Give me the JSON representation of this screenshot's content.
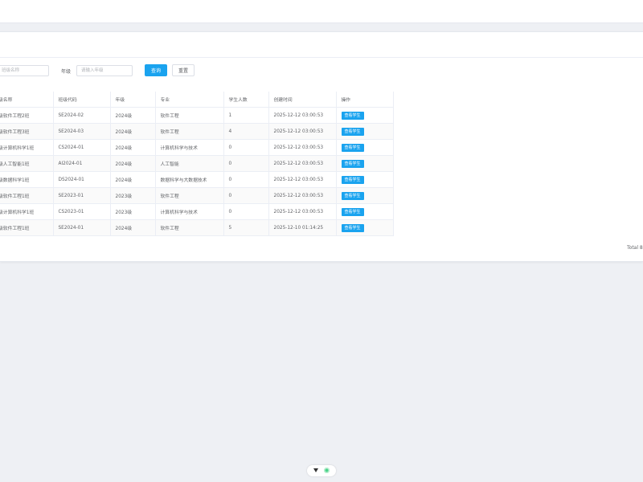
{
  "search": {
    "class_name_placeholder": "班级名称",
    "grade_label": "年级",
    "grade_placeholder": "请输入年级",
    "query_button": "查询",
    "reset_button": "重置"
  },
  "table": {
    "headers": [
      "级名称",
      "班级代码",
      "年级",
      "专业",
      "学生人数",
      "创建时间",
      "操作"
    ],
    "rows": [
      {
        "name": "级软件工程2班",
        "code": "SE2024-02",
        "grade": "2024级",
        "major": "软件工程",
        "count": "1",
        "created": "2025-12-12 03:00:53",
        "action": "查看学生"
      },
      {
        "name": "级软件工程3班",
        "code": "SE2024-03",
        "grade": "2024级",
        "major": "软件工程",
        "count": "4",
        "created": "2025-12-12 03:00:53",
        "action": "查看学生"
      },
      {
        "name": "级计算机科学1班",
        "code": "CS2024-01",
        "grade": "2024级",
        "major": "计算机科学与技术",
        "count": "0",
        "created": "2025-12-12 03:00:53",
        "action": "查看学生"
      },
      {
        "name": "级人工智能1班",
        "code": "AI2024-01",
        "grade": "2024级",
        "major": "人工智能",
        "count": "0",
        "created": "2025-12-12 03:00:53",
        "action": "查看学生"
      },
      {
        "name": "级数据科学1班",
        "code": "DS2024-01",
        "grade": "2024级",
        "major": "数据科学与大数据技术",
        "count": "0",
        "created": "2025-12-12 03:00:53",
        "action": "查看学生"
      },
      {
        "name": "级软件工程1班",
        "code": "SE2023-01",
        "grade": "2023级",
        "major": "软件工程",
        "count": "0",
        "created": "2025-12-12 03:00:53",
        "action": "查看学生"
      },
      {
        "name": "级计算机科学1班",
        "code": "CS2023-01",
        "grade": "2023级",
        "major": "计算机科学与技术",
        "count": "0",
        "created": "2025-12-12 03:00:53",
        "action": "查看学生"
      },
      {
        "name": "级软件工程1班",
        "code": "SE2024-01",
        "grade": "2024级",
        "major": "软件工程",
        "count": "5",
        "created": "2025-12-10 01:14:25",
        "action": "查看学生"
      }
    ]
  },
  "pagination": {
    "total_text": "Total 8"
  },
  "bottom_tool": {
    "icons": [
      "triangle-down-icon",
      "green-dot-icon"
    ]
  },
  "colors": {
    "primary": "#1aa3ef",
    "page_background": "#eef0f4",
    "border": "#ebeef5"
  }
}
